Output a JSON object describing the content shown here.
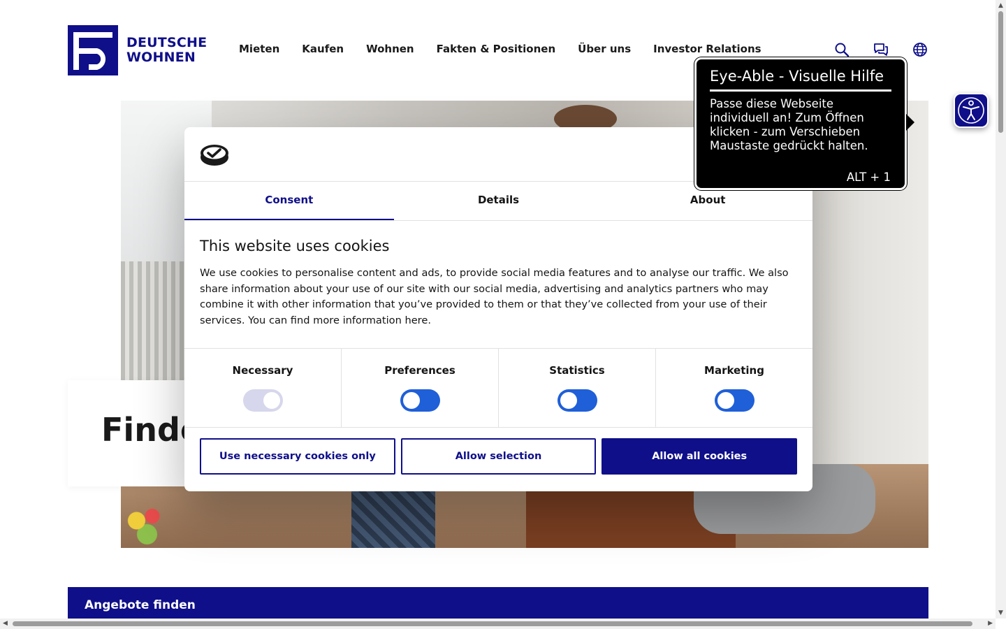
{
  "brand": {
    "line1": "DEUTSCHE",
    "line2": "WOHNEN",
    "color": "#0f0f8a"
  },
  "nav": {
    "items": [
      {
        "label": "Mieten"
      },
      {
        "label": "Kaufen"
      },
      {
        "label": "Wohnen"
      },
      {
        "label": "Fakten & Positionen"
      },
      {
        "label": "Über uns"
      },
      {
        "label": "Investor Relations"
      }
    ]
  },
  "header_icons": [
    "search-icon",
    "chat-icon",
    "globe-icon"
  ],
  "hero": {
    "finder_title": "Finde"
  },
  "offers": {
    "label": "Angebote finden"
  },
  "cookie": {
    "tabs": [
      {
        "label": "Consent",
        "active": true
      },
      {
        "label": "Details",
        "active": false
      },
      {
        "label": "About",
        "active": false
      }
    ],
    "heading": "This website uses cookies",
    "text": "We use cookies to personalise content and ads, to provide social media features and to analyse our traffic. We also share information about your use of our site with our social media, advertising and analytics part­ners who may combine it with other information that you’ve provided to them or that they’ve collected from your use of their services. You can find more information here.",
    "categories": [
      {
        "label": "Necessary",
        "state": "on-disabled"
      },
      {
        "label": "Preferences",
        "state": "off"
      },
      {
        "label": "Statistics",
        "state": "off"
      },
      {
        "label": "Marketing",
        "state": "off"
      }
    ],
    "buttons": {
      "necessary_only": "Use necessary cookies only",
      "allow_selection": "Allow selection",
      "allow_all": "Allow all cookies"
    }
  },
  "eye_able": {
    "title": "Eye-Able - Visuelle Hilfe",
    "body": "Passe diese Webseite individuell an! Zum Öffnen klicken - zum Verschieben Maustaste gedrückt halten.",
    "shortcut": "ALT + 1"
  }
}
